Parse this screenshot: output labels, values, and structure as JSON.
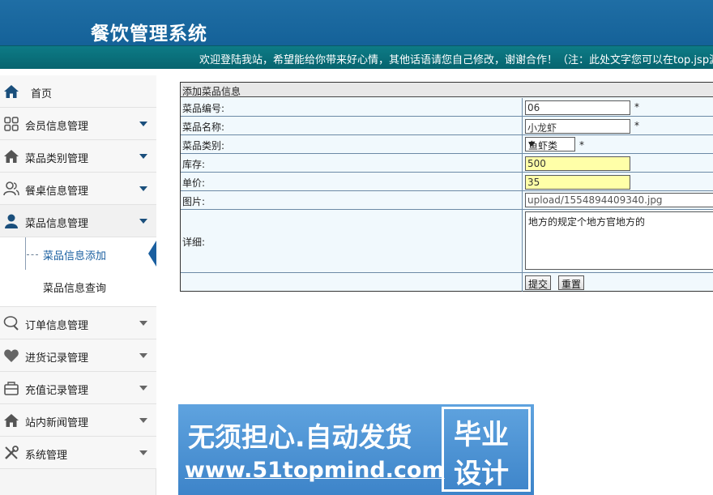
{
  "header": {
    "title": "餐饮管理系统",
    "welcome": "欢迎登陆我站，希望能给你带来好心情，其他话语请您自己修改，谢谢合作！（注：此处文字您可以在top.jsp源"
  },
  "sidebar": {
    "home": "首页",
    "items": [
      {
        "label": "会员信息管理",
        "icon": "grid-icon"
      },
      {
        "label": "菜品类别管理",
        "icon": "home-icon"
      },
      {
        "label": "餐桌信息管理",
        "icon": "users-icon"
      },
      {
        "label": "菜品信息管理",
        "icon": "person-icon"
      },
      {
        "label": "订单信息管理",
        "icon": "chat-icon"
      },
      {
        "label": "进货记录管理",
        "icon": "heart-icon"
      },
      {
        "label": "充值记录管理",
        "icon": "package-icon"
      },
      {
        "label": "站内新闻管理",
        "icon": "home-icon"
      },
      {
        "label": "系统管理",
        "icon": "tools-icon"
      }
    ],
    "sub_items": [
      "菜品信息添加",
      "菜品信息查询"
    ]
  },
  "form": {
    "title": "添加菜品信息",
    "fields": {
      "code": {
        "label": "菜品编号:",
        "value": "06"
      },
      "name": {
        "label": "菜品名称:",
        "value": "小龙虾"
      },
      "category": {
        "label": "菜品类别:",
        "value": "鱼虾类"
      },
      "stock": {
        "label": "库存:",
        "value": "500"
      },
      "price": {
        "label": "单价:",
        "value": "35"
      },
      "image": {
        "label": "图片:",
        "value": "upload/1554894409340.jpg"
      },
      "detail": {
        "label": "详细:",
        "value": "地方的规定个地方官地方的"
      }
    },
    "required_mark": "*",
    "submit_label": "提交",
    "reset_label": "重置"
  },
  "banner": {
    "slogan": "无须担心.自动发货",
    "url": "www.51topmind.com",
    "box_line1": "毕业",
    "box_line2": "设计"
  },
  "colors": {
    "header_blue": "#1a6aa3",
    "strip_teal": "#0a717d",
    "accent": "#1a5fa0",
    "highlight_input": "#ffffa8"
  }
}
